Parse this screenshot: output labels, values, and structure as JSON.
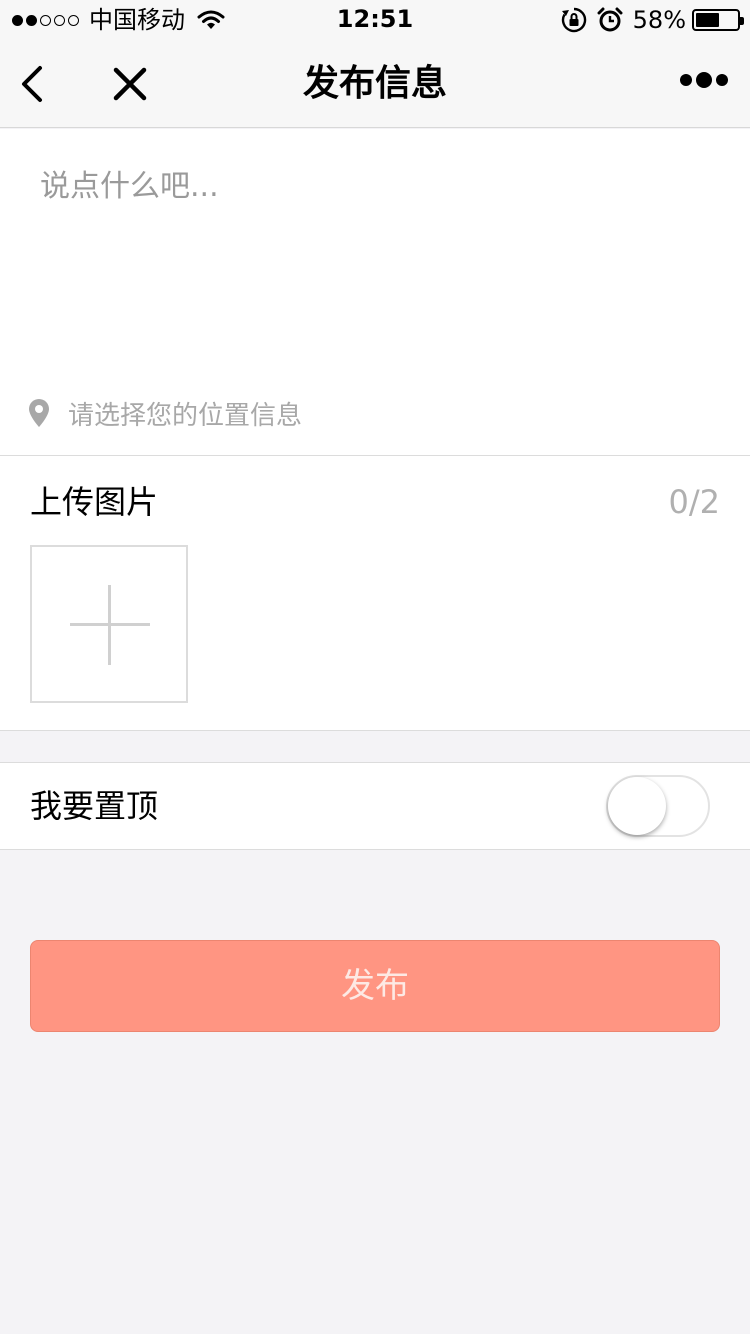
{
  "status_bar": {
    "carrier": "中国移动",
    "time": "12:51",
    "battery_percent": "58%",
    "battery_level": 0.58,
    "signal_filled": 2,
    "signal_total": 5
  },
  "nav": {
    "title": "发布信息",
    "back_icon": "chevron-left-icon",
    "close_icon": "close-icon",
    "more_icon": "more-dots-icon"
  },
  "post": {
    "placeholder": "说点什么吧...",
    "value": "",
    "location_placeholder": "请选择您的位置信息"
  },
  "upload": {
    "title": "上传图片",
    "count": "0/2"
  },
  "pin_top": {
    "label": "我要置顶",
    "enabled": false
  },
  "publish": {
    "label": "发布"
  },
  "colors": {
    "background": "#f4f3f6",
    "publish_button": "#ff9582"
  }
}
